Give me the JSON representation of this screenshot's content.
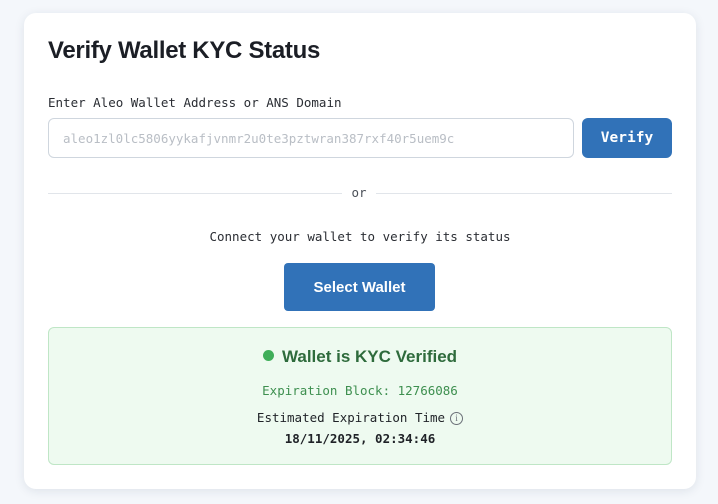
{
  "page": {
    "title": "Verify Wallet KYC Status"
  },
  "address_field": {
    "label": "Enter Aleo Wallet Address or ANS Domain",
    "value": "",
    "placeholder": "aleo1zl0lc5806yykafjvnmr2u0te3pztwran387rxf40r5uem9c"
  },
  "buttons": {
    "verify_label": "Verify",
    "select_wallet_label": "Select Wallet"
  },
  "divider": {
    "text": "or"
  },
  "connect": {
    "text": "Connect your wallet to verify its status"
  },
  "status": {
    "heading": "Wallet is KYC Verified",
    "expiration_block": "Expiration Block: 12766086",
    "estimated_label": "Estimated Expiration Time",
    "estimated_value": "18/11/2025, 02:34:46",
    "icons": {
      "status_dot": "status-dot-icon",
      "info": "info-icon"
    }
  },
  "colors": {
    "accent": "#3172b8",
    "success_bg": "#eefaf0",
    "success_border": "#bfe6c6",
    "success_text": "#2e6b3c",
    "success_dot": "#3fae59"
  }
}
